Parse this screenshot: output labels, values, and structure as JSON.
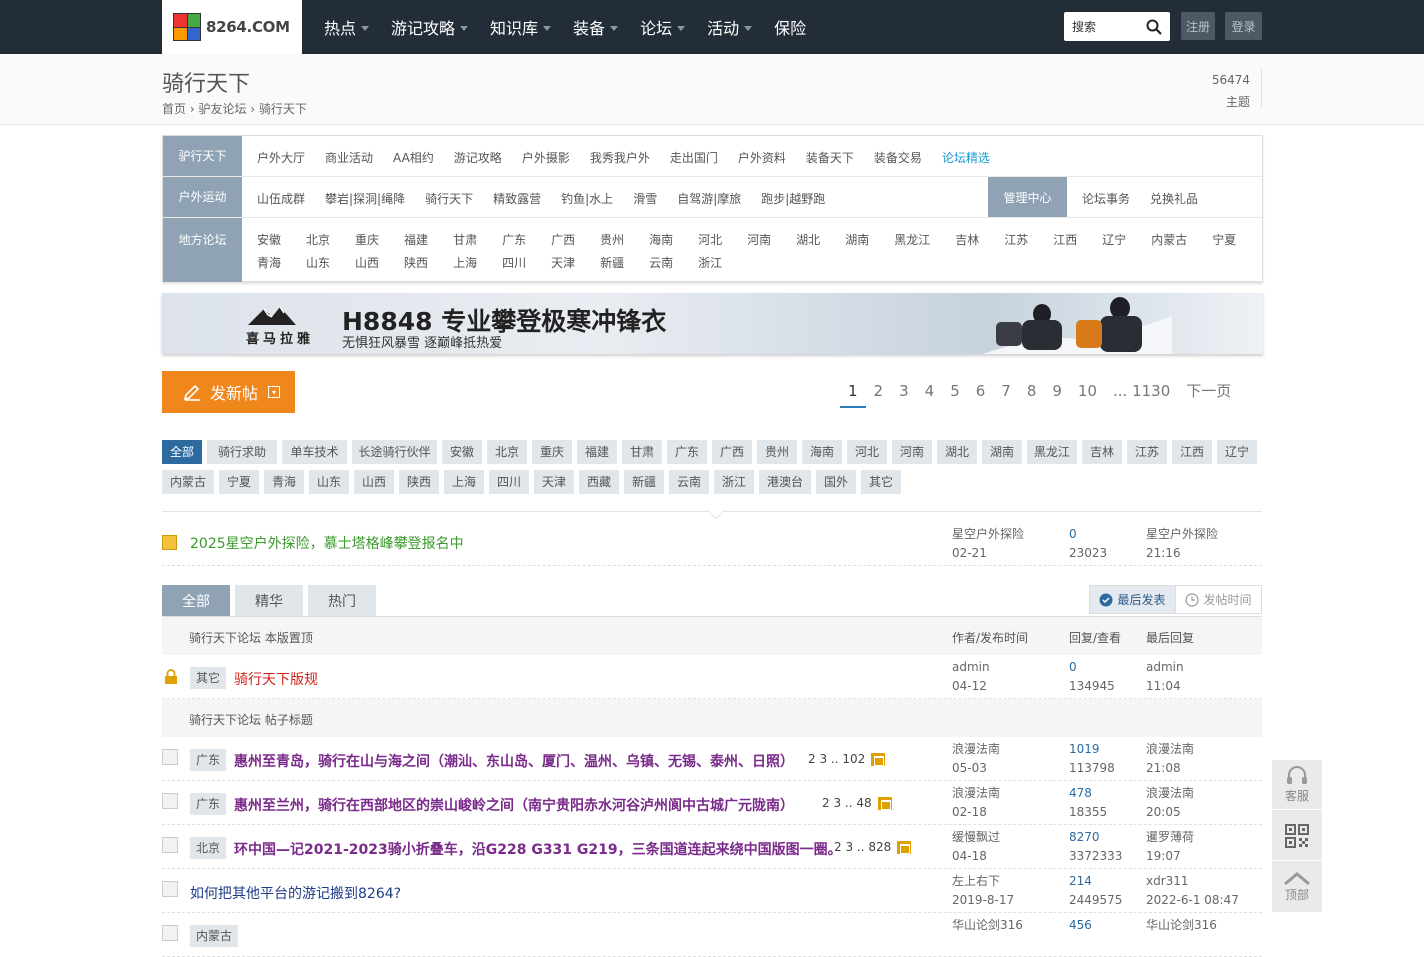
{
  "brand": {
    "name": "8264.COM"
  },
  "nav": [
    {
      "label": "热点",
      "caret": true
    },
    {
      "label": "游记攻略",
      "caret": true
    },
    {
      "label": "知识库",
      "caret": true
    },
    {
      "label": "装备",
      "caret": true
    },
    {
      "label": "论坛",
      "caret": true
    },
    {
      "label": "活动",
      "caret": true
    },
    {
      "label": "保险",
      "caret": false
    }
  ],
  "search": {
    "placeholder": "搜索"
  },
  "auth": {
    "register": "注册",
    "login": "登录"
  },
  "page": {
    "title": "骑行天下",
    "breadcrumb": [
      "首页",
      "驴友论坛",
      "骑行天下"
    ],
    "topic_count": "56474",
    "topic_label": "主题"
  },
  "forum_menu": {
    "row1": {
      "head": "驴行天下",
      "items": [
        "户外大厅",
        "商业活动",
        "AA相约",
        "游记攻略",
        "户外摄影",
        "我秀我户外",
        "走出国门",
        "户外资料",
        "装备天下",
        "装备交易",
        "论坛精选"
      ]
    },
    "row2": {
      "head": "户外运动",
      "items": [
        "山伍成群",
        "攀岩|探洞|绳降",
        "骑行天下",
        "精致露营",
        "钓鱼|水上",
        "滑雪",
        "自驾游|摩旅",
        "跑步|越野跑"
      ],
      "mgr": "管理中心",
      "mgr_items": [
        "论坛事务",
        "兑换礼品"
      ]
    },
    "row3": {
      "head": "地方论坛",
      "items1": [
        "安徽",
        "北京",
        "重庆",
        "福建",
        "甘肃",
        "广东",
        "广西",
        "贵州",
        "海南",
        "河北",
        "河南",
        "湖北",
        "湖南",
        "黑龙江",
        "吉林",
        "江苏",
        "江西",
        "辽宁",
        "内蒙古",
        "宁夏"
      ],
      "items2": [
        "青海",
        "山东",
        "山西",
        "陕西",
        "上海",
        "四川",
        "天津",
        "新疆",
        "云南",
        "浙江"
      ]
    }
  },
  "banner": {
    "brand": "喜马拉雅",
    "headline": "H8848 专业攀登极寒冲锋衣",
    "sub": "无惧狂风暴雪 逐巅峰抵热爱"
  },
  "new_post": {
    "label": "发新帖"
  },
  "pager": {
    "pages": [
      "1",
      "2",
      "3",
      "4",
      "5",
      "6",
      "7",
      "8",
      "9",
      "10",
      "... 1130",
      "下一页"
    ]
  },
  "tags": {
    "row1": [
      "全部",
      "骑行求助",
      "单车技术",
      "长途骑行伙伴",
      "安徽",
      "北京",
      "重庆",
      "福建",
      "甘肃",
      "广东",
      "广西",
      "贵州",
      "海南",
      "河北",
      "河南",
      "湖北",
      "湖南",
      "黑龙江",
      "吉林",
      "江苏",
      "江西",
      "辽宁"
    ],
    "row2": [
      "内蒙古",
      "宁夏",
      "青海",
      "山东",
      "山西",
      "陕西",
      "上海",
      "四川",
      "天津",
      "西藏",
      "新疆",
      "云南",
      "浙江",
      "港澳台",
      "国外",
      "其它"
    ]
  },
  "announcement": {
    "title": "2025星空户外探险，慕士塔格峰攀登报名中",
    "author": "星空户外探险",
    "date": "02-21",
    "replies": "0",
    "views": "23023",
    "last_user": "星空户外探险",
    "last_time": "21:16"
  },
  "tabs": [
    "全部",
    "精华",
    "热门"
  ],
  "sort": {
    "latest": "最后发表",
    "post_time": "发帖时间"
  },
  "table_head": {
    "section": "骑行天下论坛 本版置顶",
    "author": "作者/发布时间",
    "reply": "回复/查看",
    "last": "最后回复"
  },
  "sticky": {
    "tag": "其它",
    "title": "骑行天下版规",
    "author": "admin",
    "date": "04-12",
    "replies": "0",
    "views": "134945",
    "last_user": "admin",
    "last_time": "11:04"
  },
  "section2": "骑行天下论坛 帖子标题",
  "threads": [
    {
      "tag": "广东",
      "title": "惠州至青岛，骑行在山与海之间（潮汕、东山岛、厦门、温州、乌镇、无锡、泰州、日照）",
      "pages": "2 3 .. 102",
      "author": "浪漫法南",
      "date": "05-03",
      "replies": "1019",
      "views": "113798",
      "last_user": "浪漫法南",
      "last_time": "21:08"
    },
    {
      "tag": "广东",
      "title": "惠州至兰州，骑行在西部地区的崇山峻岭之间（南宁贵阳赤水河谷泸州阆中古城广元陇南）",
      "pages": "2 3 .. 48",
      "author": "浪漫法南",
      "date": "02-18",
      "replies": "478",
      "views": "18355",
      "last_user": "浪漫法南",
      "last_time": "20:05"
    },
    {
      "tag": "北京",
      "title": "环中国—记2021-2023骑小折叠车，沿G228 G331 G219，三条国道连起来绕中国版图一圈。",
      "pages": "2 3 .. 828",
      "author": "缓慢飘过",
      "date": "04-18",
      "replies": "8270",
      "views": "3372333",
      "last_user": "暹罗薄荷",
      "last_time": "19:07"
    },
    {
      "tag": "",
      "title": "如何把其他平台的游记搬到8264?",
      "pages": "",
      "author": "左上右下",
      "date": "2019-8-17",
      "replies": "214",
      "views": "2449575",
      "last_user": "xdr311",
      "last_time": "2022-6-1 08:47"
    },
    {
      "tag": "内蒙古",
      "title": "",
      "pages": "",
      "author": "华山论剑316",
      "date": "",
      "replies": "456",
      "views": "",
      "last_user": "华山论剑316",
      "last_time": ""
    }
  ],
  "side": {
    "service": "客服",
    "top": "顶部"
  },
  "colors": {
    "topbar": "#222d38",
    "accent": "#f0871c",
    "menuhead": "#8fa3b5",
    "link": "#2c6aa0",
    "thread": "#7a2a8a",
    "sticky": "#d0231b"
  }
}
